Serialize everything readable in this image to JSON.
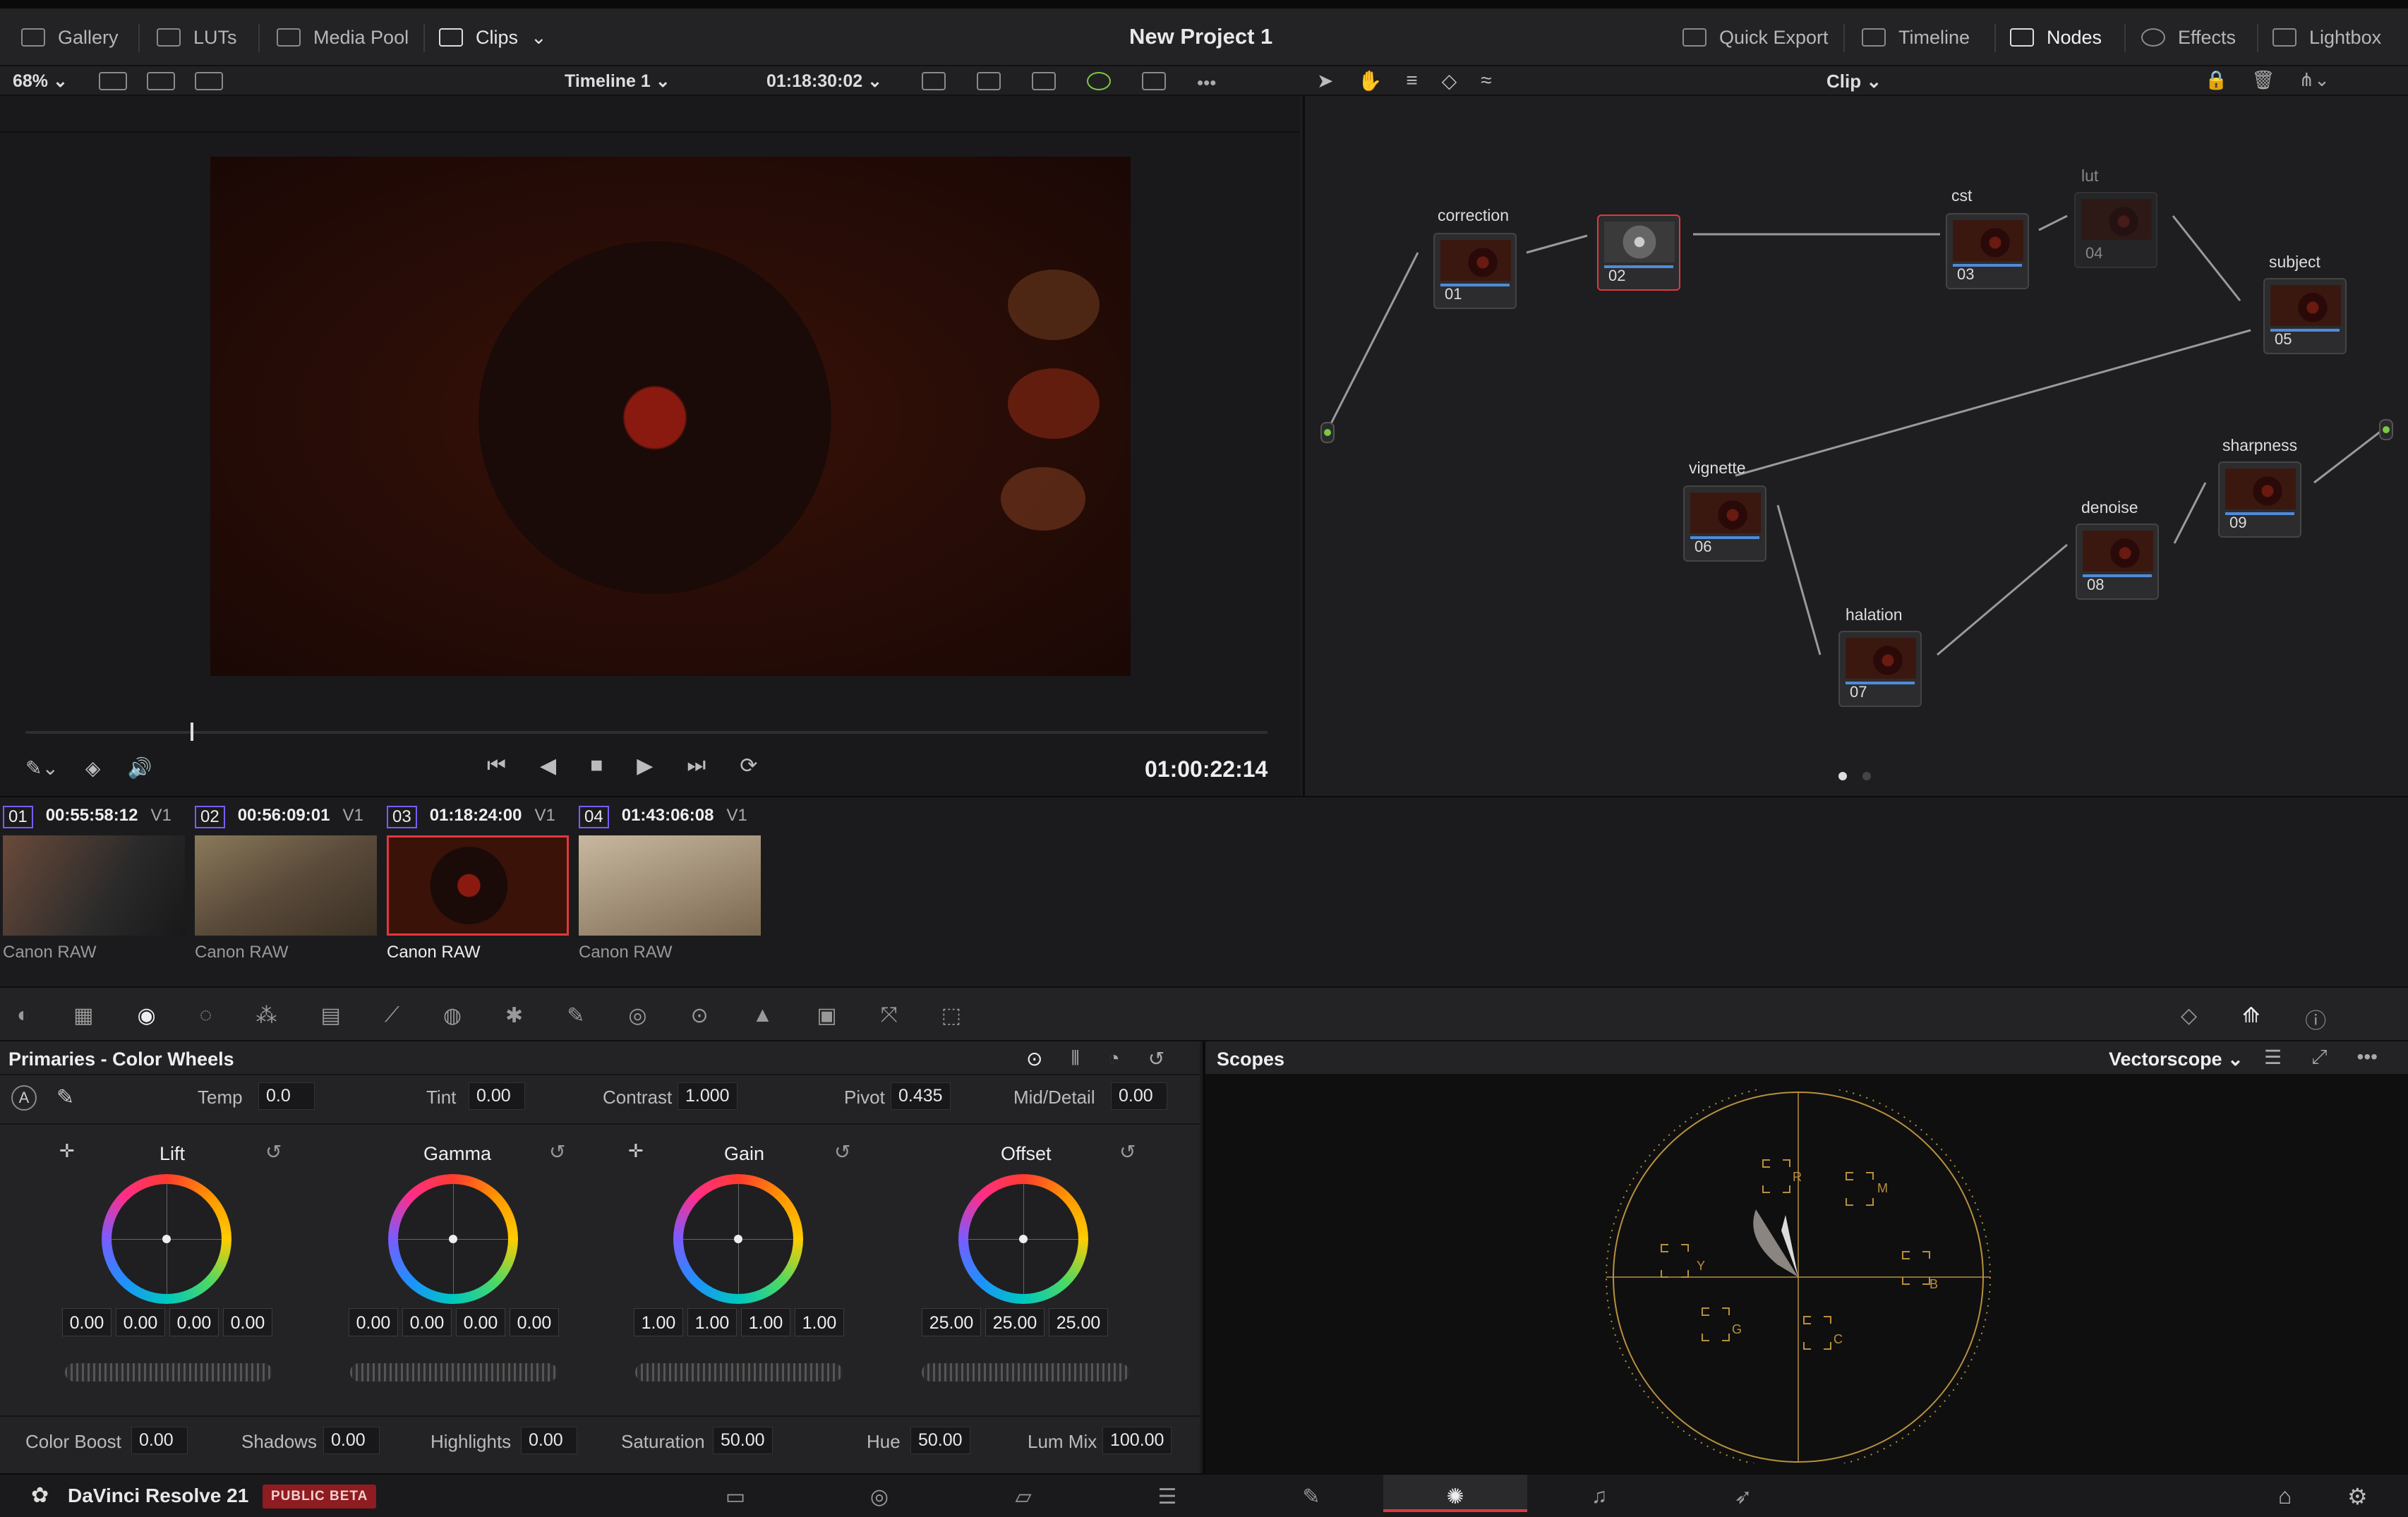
{
  "topbar": {
    "title": "New Project 1",
    "left": [
      {
        "label": "Gallery",
        "icon": "gallery-icon"
      },
      {
        "label": "LUTs",
        "icon": "luts-icon"
      },
      {
        "label": "Media Pool",
        "icon": "media-pool-icon"
      },
      {
        "label": "Clips",
        "icon": "clips-icon"
      }
    ],
    "right": [
      {
        "label": "Quick Export",
        "icon": "export-icon"
      },
      {
        "label": "Timeline",
        "icon": "timeline-icon"
      },
      {
        "label": "Nodes",
        "icon": "nodes-icon"
      },
      {
        "label": "Effects",
        "icon": "effects-icon"
      },
      {
        "label": "Lightbox",
        "icon": "lightbox-icon"
      }
    ]
  },
  "viewer": {
    "zoom": "68%",
    "timeline_name": "Timeline 1",
    "source_timecode": "01:18:30:02",
    "current_timecode": "01:00:22:14",
    "node_mode": "Clip"
  },
  "nodes": [
    {
      "num": "01",
      "label": "correction"
    },
    {
      "num": "02",
      "label": ""
    },
    {
      "num": "03",
      "label": "cst"
    },
    {
      "num": "04",
      "label": "lut"
    },
    {
      "num": "05",
      "label": "subject"
    },
    {
      "num": "06",
      "label": "vignette"
    },
    {
      "num": "07",
      "label": "halation"
    },
    {
      "num": "08",
      "label": "denoise"
    },
    {
      "num": "09",
      "label": "sharpness"
    }
  ],
  "clips": [
    {
      "num": "01",
      "tc": "00:55:58:12",
      "track": "V1",
      "codec": "Canon RAW"
    },
    {
      "num": "02",
      "tc": "00:56:09:01",
      "track": "V1",
      "codec": "Canon RAW"
    },
    {
      "num": "03",
      "tc": "01:18:24:00",
      "track": "V1",
      "codec": "Canon RAW"
    },
    {
      "num": "04",
      "tc": "01:43:06:08",
      "track": "V1",
      "codec": "Canon RAW"
    }
  ],
  "primaries": {
    "title": "Primaries - Color Wheels",
    "temp_label": "Temp",
    "temp": "0.0",
    "tint_label": "Tint",
    "tint": "0.00",
    "contrast_label": "Contrast",
    "contrast": "1.000",
    "pivot_label": "Pivot",
    "pivot": "0.435",
    "middetail_label": "Mid/Detail",
    "middetail": "0.00",
    "wheels": [
      {
        "name": "Lift",
        "values": [
          "0.00",
          "0.00",
          "0.00",
          "0.00"
        ]
      },
      {
        "name": "Gamma",
        "values": [
          "0.00",
          "0.00",
          "0.00",
          "0.00"
        ]
      },
      {
        "name": "Gain",
        "values": [
          "1.00",
          "1.00",
          "1.00",
          "1.00"
        ]
      },
      {
        "name": "Offset",
        "values": [
          "25.00",
          "25.00",
          "25.00"
        ]
      }
    ],
    "colorboost_label": "Color Boost",
    "colorboost": "0.00",
    "shadows_label": "Shadows",
    "shadows": "0.00",
    "highlights_label": "Highlights",
    "highlights": "0.00",
    "saturation_label": "Saturation",
    "saturation": "50.00",
    "hue_label": "Hue",
    "hue": "50.00",
    "lummix_label": "Lum Mix",
    "lummix": "100.00"
  },
  "scopes": {
    "title": "Scopes",
    "mode": "Vectorscope",
    "targets": [
      "R",
      "M",
      "Y",
      "B",
      "G",
      "C"
    ]
  },
  "footer": {
    "app": "DaVinci Resolve 21",
    "badge": "PUBLIC BETA"
  },
  "colors": {
    "accent": "#e0383e",
    "node_green": "#7ac943",
    "node_blue": "#1fa3e6",
    "scope_gold": "#b8903c"
  }
}
